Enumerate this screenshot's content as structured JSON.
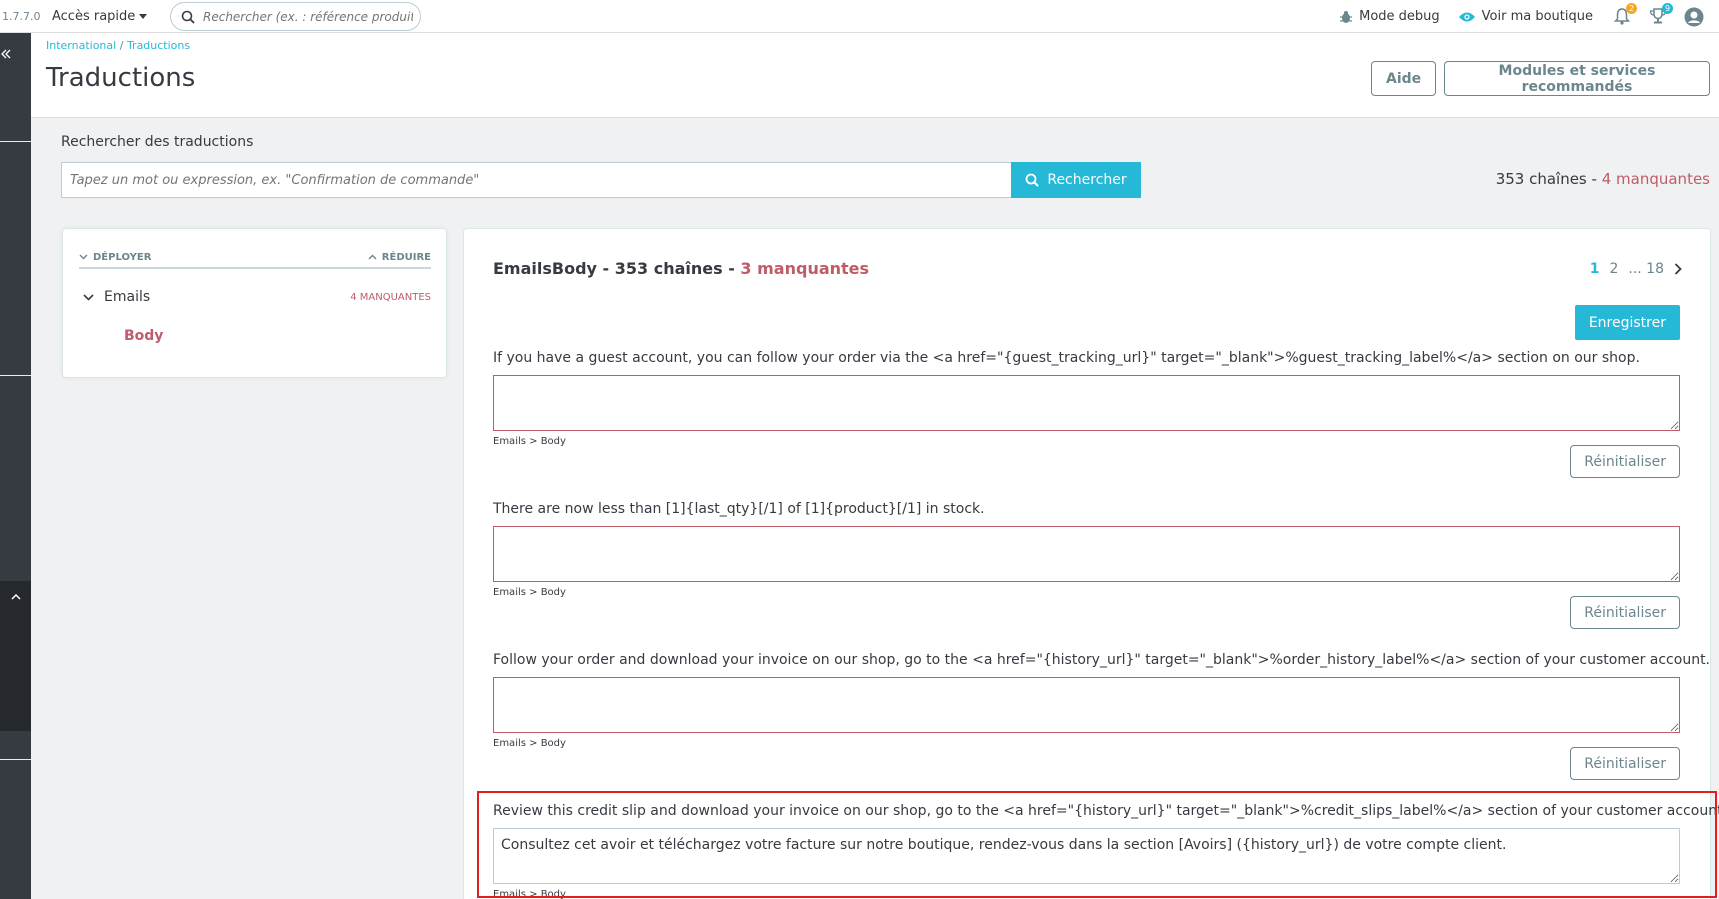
{
  "header": {
    "version": "1.7.7.0",
    "quick_access": "Accès rapide",
    "search_placeholder": "Rechercher (ex. : référence produit, nom",
    "debug_label": "Mode debug",
    "shop_label": "Voir ma boutique",
    "notifications_count": "2",
    "trophy_count": "9",
    "colors": {
      "accent": "#25b9d7",
      "badge_orange": "#f5a623",
      "badge_blue": "#25b9d7"
    }
  },
  "breadcrumb": {
    "parent": "International",
    "separator": "/",
    "current": "Traductions"
  },
  "page": {
    "title": "Traductions",
    "help_button": "Aide",
    "modules_button": "Modules et services recommandés"
  },
  "search": {
    "label": "Rechercher des traductions",
    "placeholder": "Tapez un mot ou expression, ex. \"Confirmation de commande\"",
    "button": "Rechercher",
    "totals_strings": "353 chaînes -",
    "totals_missing": "4 manquantes"
  },
  "tree": {
    "expand": "DÉPLOYER",
    "collapse": "RÉDUIRE",
    "node_label": "Emails",
    "node_missing": "4 MANQUANTES",
    "child_label": "Body"
  },
  "main": {
    "title": "EmailsBody - 353 chaînes -",
    "title_missing": "3 manquantes",
    "pages": [
      "1",
      "2",
      "... 18"
    ],
    "save_button": "Enregistrer",
    "reset_label": "Réinitialiser",
    "entries": [
      {
        "source": "If you have a guest account, you can follow your order via the <a href=\"{guest_tracking_url}\" target=\"_blank\">%guest_tracking_label%</a> section on our shop.",
        "translation": "",
        "path": "Emails > Body"
      },
      {
        "source": "There are now less than [1]{last_qty}[/1] of [1]{product}[/1] in stock.",
        "translation": "",
        "path": "Emails > Body"
      },
      {
        "source": "Follow your order and download your invoice on our shop, go to the <a href=\"{history_url}\" target=\"_blank\">%order_history_label%</a> section of your customer account.",
        "translation": "",
        "path": "Emails > Body"
      },
      {
        "source": "Review this credit slip and download your invoice on our shop, go to the <a href=\"{history_url}\" target=\"_blank\">%credit_slips_label%</a> section of your customer account.",
        "translation": "Consultez cet avoir et téléchargez votre facture sur notre boutique, rendez-vous dans la section [Avoirs] ({history_url}) de votre compte client.",
        "path": "Emails > Body"
      }
    ]
  }
}
